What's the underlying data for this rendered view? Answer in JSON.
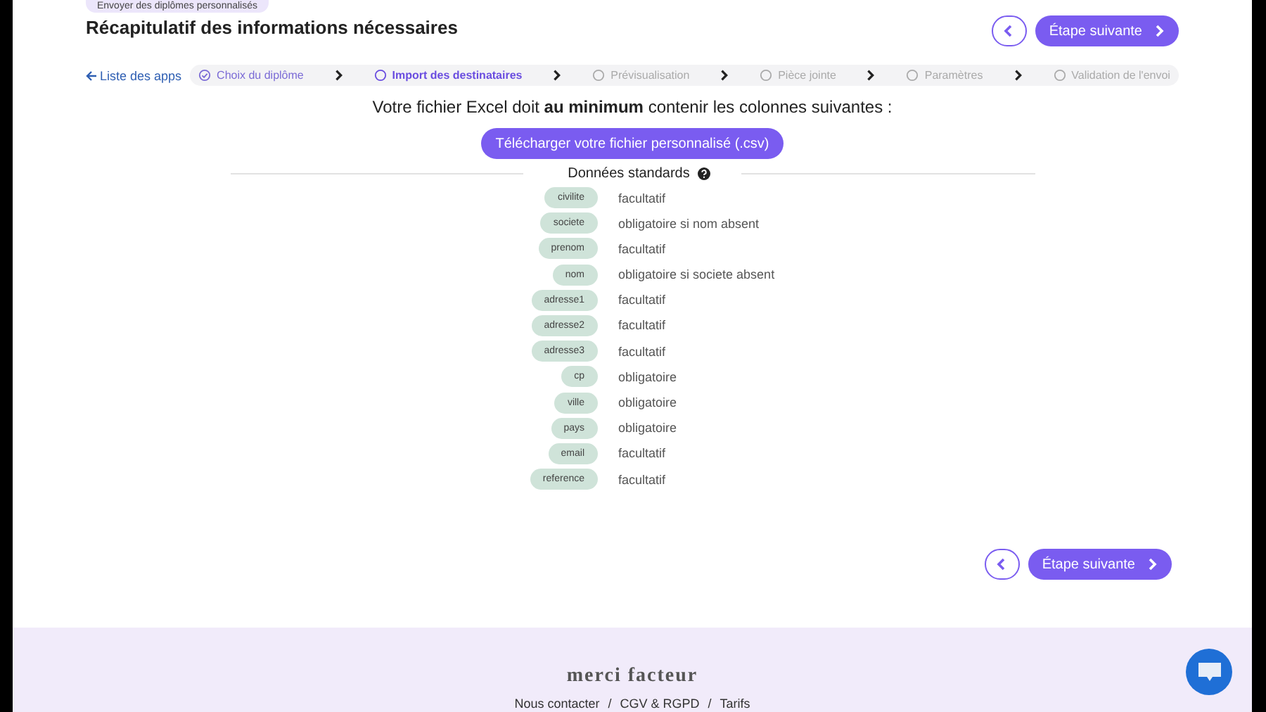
{
  "badge": "Envoyer des diplômes personnalisés",
  "title": "Récapitulatif des informations nécessaires",
  "nav": {
    "back_link": "Liste des apps",
    "next_label": "Étape suivante"
  },
  "steps": [
    {
      "label": "Choix du diplôme",
      "completed": true,
      "selected": false
    },
    {
      "label": "Import des destinataires",
      "completed": false,
      "selected": true
    },
    {
      "label": "Prévisualisation",
      "completed": false,
      "selected": false
    },
    {
      "label": "Pièce jointe",
      "completed": false,
      "selected": false
    },
    {
      "label": "Paramètres",
      "completed": false,
      "selected": false
    },
    {
      "label": "Validation de l'envoi",
      "completed": false,
      "selected": false
    }
  ],
  "heading": "Votre fichier Excel doit **au minimum** contenir les colonnes suivantes :",
  "download_button": "Télécharger votre fichier personnalisé (.csv)",
  "section_title": "Données standards",
  "fields": [
    {
      "name": "civilite",
      "rule": "facultatif"
    },
    {
      "name": "societe",
      "rule": "obligatoire si nom absent"
    },
    {
      "name": "prenom",
      "rule": "facultatif"
    },
    {
      "name": "nom",
      "rule": "obligatoire si societe absent"
    },
    {
      "name": "adresse1",
      "rule": "facultatif"
    },
    {
      "name": "adresse2",
      "rule": "facultatif"
    },
    {
      "name": "adresse3",
      "rule": "facultatif"
    },
    {
      "name": "cp",
      "rule": "obligatoire"
    },
    {
      "name": "ville",
      "rule": "obligatoire"
    },
    {
      "name": "pays",
      "rule": "obligatoire"
    },
    {
      "name": "email",
      "rule": "facultatif"
    },
    {
      "name": "reference",
      "rule": "facultatif"
    }
  ],
  "bottom_nav": {
    "next_label": "Étape suivante"
  },
  "footer": {
    "logo": "merci facteur",
    "links": [
      "Nous contacter",
      "CGV & RGPD",
      "Tarifs"
    ],
    "separator": "/"
  }
}
